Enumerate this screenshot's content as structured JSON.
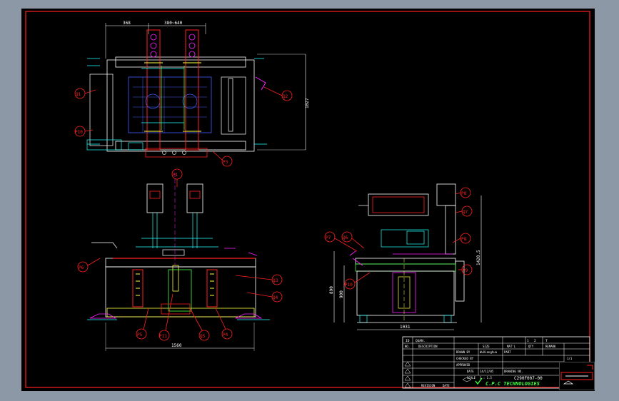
{
  "colors": {
    "background": "#000000",
    "frame": "#ff2020",
    "magenta": "#ff20ff",
    "cyan": "#20ffff",
    "yellow": "#ffff40",
    "green": "#40ff40",
    "blue": "#4060ff",
    "white": "#ffffff",
    "canvas_bg": "#8c98a6"
  },
  "top_view": {
    "dim_left": "368",
    "dim_right": "380~640",
    "dim_height": "1027",
    "callouts": [
      "Q1",
      "P10",
      "Q2",
      "P3"
    ]
  },
  "front_view": {
    "dim_width": "1560",
    "callouts": [
      "P1",
      "P6",
      "Q3",
      "Q4",
      "P5",
      "P11",
      "Q5",
      "P4"
    ]
  },
  "side_view": {
    "dim_width": "1031",
    "dim_height_left": "890",
    "dim_height_inner": "900",
    "dim_height_right": "1420.5",
    "callouts": [
      "P8",
      "Q7",
      "P7",
      "Q6",
      "P8",
      "P9",
      "P10"
    ]
  },
  "title_block": {
    "header_row": [
      "ID",
      "QUAN.",
      "",
      "",
      "",
      "",
      "",
      "1",
      "2",
      "T"
    ],
    "row2": [
      "NO.",
      "DESCRIPTION",
      "SIZE",
      "MAT'L",
      "QTY",
      "REMARK"
    ],
    "drawn_by": "DRAWN BY",
    "drawn_name": "WuXianghua",
    "checked_by": "CHECKED BY",
    "approved": "APPROVED",
    "date_label": "DATE",
    "date_value": "14/12/05",
    "scale_label": "SCALE",
    "scale_value": "1 : 1.5",
    "rev_label": "REVISION",
    "date_col": "DATE",
    "drawing_no_label": "DRAWING NO.",
    "drawing_no": "C290F007-00",
    "company": "C.P.C TECHNOLOGIES",
    "part_label": "PART",
    "page_info": "1/1"
  }
}
